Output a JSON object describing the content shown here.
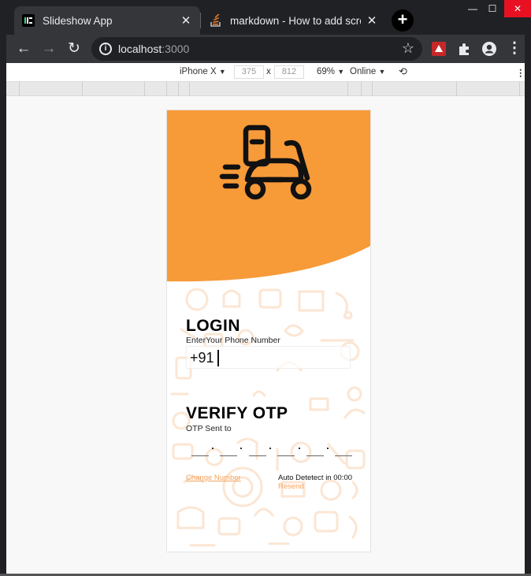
{
  "browser": {
    "tabs": [
      {
        "title": "Slideshow App",
        "close": "✕",
        "favicon": "slideshow-favicon"
      },
      {
        "title": "markdown - How to add screens",
        "close": "✕",
        "favicon": "stackoverflow-favicon"
      }
    ],
    "new_tab": "+",
    "window_controls": {
      "minimize": "—",
      "maximize": "☐",
      "close": "✕"
    },
    "address": {
      "host": "localhost",
      "port": ":3000"
    },
    "nav": {
      "back": "←",
      "forward": "→",
      "reload": "↻",
      "star": "☆",
      "menu": "⋮"
    }
  },
  "devtools": {
    "device": "iPhone X",
    "width": "375",
    "times": "x",
    "height": "812",
    "zoom": "69%",
    "network": "Online",
    "dropdown": "▼",
    "rotate": "⟲",
    "menu": "⋮"
  },
  "app": {
    "hero_icon": "scooter-delivery-icon",
    "accent_color": "#f79a38",
    "login": {
      "title": "LOGIN",
      "subtitle": "EnterYour Phone Number",
      "phone_prefix": "+91"
    },
    "verify": {
      "title": "VERIFY OTP",
      "subtitle": "OTP Sent to",
      "otp_slots": 6
    },
    "change_number": "Change Number",
    "auto_detect": "Auto Detetect in 00:00",
    "resend": "Resend"
  }
}
